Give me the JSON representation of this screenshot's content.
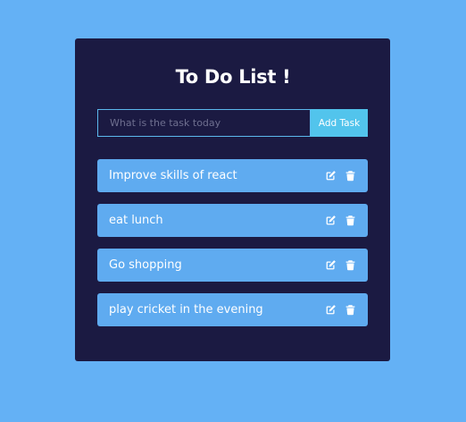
{
  "app": {
    "title": "To Do List !"
  },
  "form": {
    "placeholder": "What is the task today",
    "value": "",
    "button_label": "Add Task"
  },
  "todos": [
    {
      "task": "Improve skills of react",
      "icons": [
        "edit-icon",
        "trash-icon"
      ]
    },
    {
      "task": "eat lunch",
      "icons": [
        "edit-icon",
        "trash-icon"
      ]
    },
    {
      "task": "Go shopping",
      "icons": [
        "edit-icon",
        "trash-icon"
      ]
    },
    {
      "task": "play cricket in the evening",
      "icons": [
        "edit-icon",
        "trash-icon"
      ]
    }
  ],
  "colors": {
    "background": "#64b1f5",
    "card": "#1b1a42",
    "accent": "#52c4ec",
    "item": "#5fabf0",
    "text": "#ffffff"
  }
}
